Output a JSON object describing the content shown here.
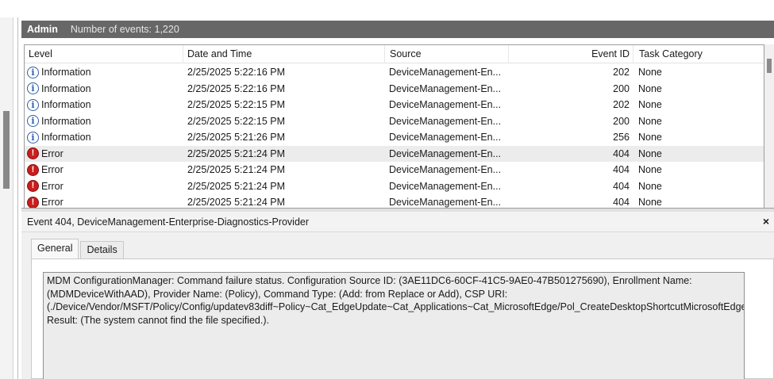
{
  "header": {
    "title": "Admin",
    "count_text": "Number of events: 1,220"
  },
  "columns": {
    "level": "Level",
    "date": "Date and Time",
    "source": "Source",
    "event_id": "Event ID",
    "task": "Task Category"
  },
  "rows": [
    {
      "level": "Information",
      "icon": "info-icon",
      "date": "2/25/2025 5:22:16 PM",
      "source": "DeviceManagement-En...",
      "event_id": "202",
      "task": "None"
    },
    {
      "level": "Information",
      "icon": "info-icon",
      "date": "2/25/2025 5:22:16 PM",
      "source": "DeviceManagement-En...",
      "event_id": "200",
      "task": "None"
    },
    {
      "level": "Information",
      "icon": "info-icon",
      "date": "2/25/2025 5:22:15 PM",
      "source": "DeviceManagement-En...",
      "event_id": "202",
      "task": "None"
    },
    {
      "level": "Information",
      "icon": "info-icon",
      "date": "2/25/2025 5:22:15 PM",
      "source": "DeviceManagement-En...",
      "event_id": "200",
      "task": "None"
    },
    {
      "level": "Information",
      "icon": "info-icon",
      "date": "2/25/2025 5:21:26 PM",
      "source": "DeviceManagement-En...",
      "event_id": "256",
      "task": "None"
    },
    {
      "level": "Error",
      "icon": "error-icon",
      "date": "2/25/2025 5:21:24 PM",
      "source": "DeviceManagement-En...",
      "event_id": "404",
      "task": "None",
      "selected": true
    },
    {
      "level": "Error",
      "icon": "error-icon",
      "date": "2/25/2025 5:21:24 PM",
      "source": "DeviceManagement-En...",
      "event_id": "404",
      "task": "None"
    },
    {
      "level": "Error",
      "icon": "error-icon",
      "date": "2/25/2025 5:21:24 PM",
      "source": "DeviceManagement-En...",
      "event_id": "404",
      "task": "None"
    },
    {
      "level": "Error",
      "icon": "error-icon",
      "date": "2/25/2025 5:21:24 PM",
      "source": "DeviceManagement-En...",
      "event_id": "404",
      "task": "None"
    }
  ],
  "detail": {
    "title": "Event 404, DeviceManagement-Enterprise-Diagnostics-Provider",
    "close_glyph": "×",
    "tabs": [
      "General",
      "Details"
    ],
    "description": "MDM ConfigurationManager: Command failure status. Configuration Source ID: (3AE11DC6-60CF-41C5-9AE0-47B501275690), Enrollment Name: (MDMDeviceWithAAD), Provider Name: (Policy), Command Type: (Add: from Replace or Add), CSP URI: (./Device/Vendor/MSFT/Policy/Config/updatev83diff~Policy~Cat_EdgeUpdate~Cat_Applications~Cat_MicrosoftEdge/Pol_CreateDesktopShortcutMicrosoftEdge), Result: (The system cannot find the file specified.)."
  },
  "icons": {
    "info": "i",
    "error": "!"
  }
}
